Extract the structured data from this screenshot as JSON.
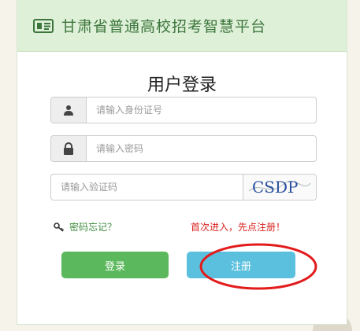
{
  "header": {
    "title": "甘肃省普通高校招考智慧平台",
    "icon": "id-card-icon"
  },
  "login": {
    "title": "用户登录",
    "id_placeholder": "请输入身份证号",
    "password_placeholder": "请输入密码",
    "captcha_placeholder": "请输入验证码",
    "captcha_text": "CSDP",
    "forgot_label": "密码忘记？",
    "first_visit_label": "首次进入，先点注册！",
    "login_button": "登录",
    "register_button": "注册"
  },
  "colors": {
    "header_bg": "#dff0d8",
    "header_text": "#3c763d",
    "login_button": "#5cb85c",
    "register_button": "#5bc0de",
    "annotation": "#e31b1b"
  }
}
